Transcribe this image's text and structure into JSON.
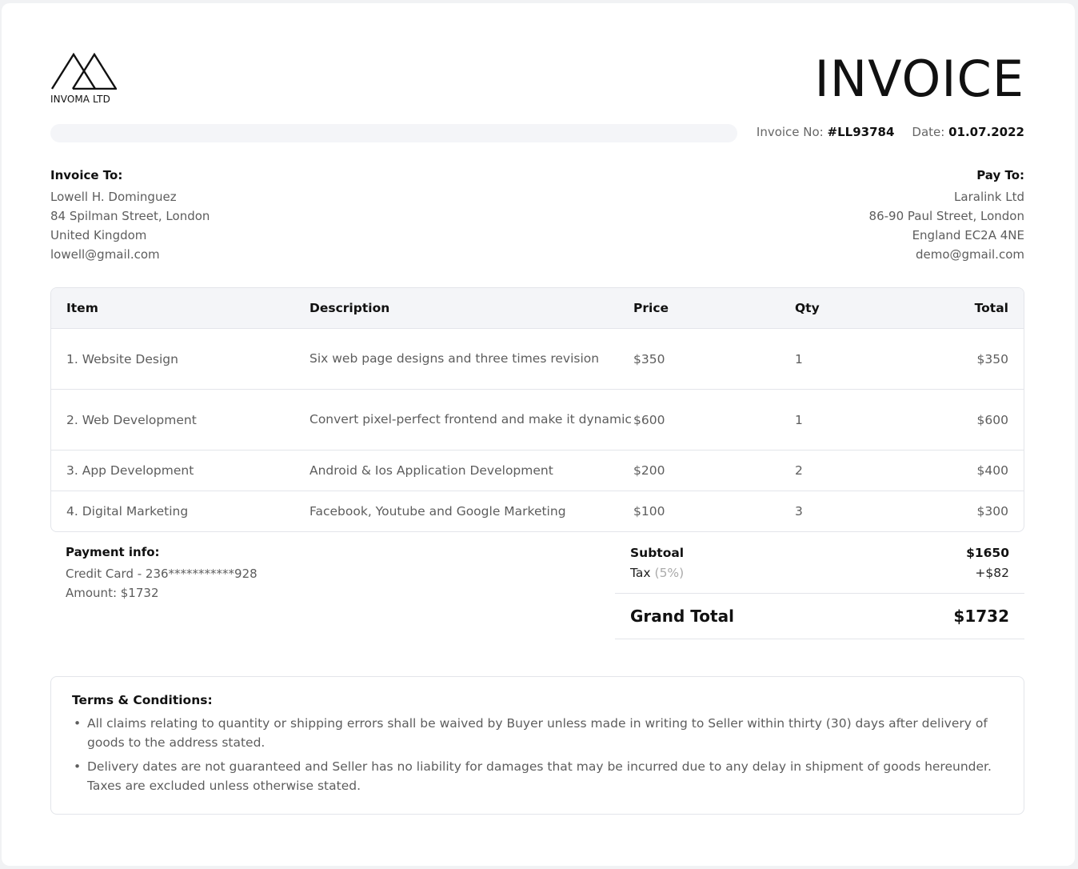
{
  "company": {
    "name": "INVOMA LTD"
  },
  "invoice": {
    "title": "INVOICE",
    "number_label": "Invoice No:",
    "number": "#LL93784",
    "date_label": "Date:",
    "date": "01.07.2022"
  },
  "invoice_to": {
    "heading": "Invoice To:",
    "lines": [
      "Lowell H. Dominguez",
      "84 Spilman Street, London",
      "United Kingdom",
      "lowell@gmail.com"
    ]
  },
  "pay_to": {
    "heading": "Pay To:",
    "lines": [
      "Laralink Ltd",
      "86-90 Paul Street, London",
      "England EC2A 4NE",
      "demo@gmail.com"
    ]
  },
  "table": {
    "headers": [
      "Item",
      "Description",
      "Price",
      "Qty",
      "Total"
    ],
    "rows": [
      [
        "1. Website Design",
        "Six web page designs and three times revision",
        "$350",
        "1",
        "$350"
      ],
      [
        "2. Web Development",
        "Convert pixel-perfect frontend and make it dynamic",
        "$600",
        "1",
        "$600"
      ],
      [
        "3. App Development",
        "Android & Ios Application Development",
        "$200",
        "2",
        "$400"
      ],
      [
        "4. Digital Marketing",
        "Facebook, Youtube and Google Marketing",
        "$100",
        "3",
        "$300"
      ]
    ]
  },
  "payment_info": {
    "heading": "Payment info:",
    "card": "Credit Card - 236***********928",
    "amount": "Amount: $1732"
  },
  "totals": {
    "subtotal_label": "Subtoal",
    "subtotal": "$1650",
    "tax_label": "Tax",
    "tax_pct": "(5%)",
    "tax": "+$82",
    "grand_label": "Grand Total",
    "grand": "$1732"
  },
  "terms": {
    "heading": "Terms & Conditions:",
    "items": [
      "All claims relating to quantity or shipping errors shall be waived by Buyer unless made in writing to Seller within thirty (30) days after delivery of goods to the address stated.",
      "Delivery dates are not guaranteed and Seller has no liability for damages that may be incurred due to any delay in shipment of goods hereunder. Taxes are excluded unless otherwise stated."
    ]
  }
}
